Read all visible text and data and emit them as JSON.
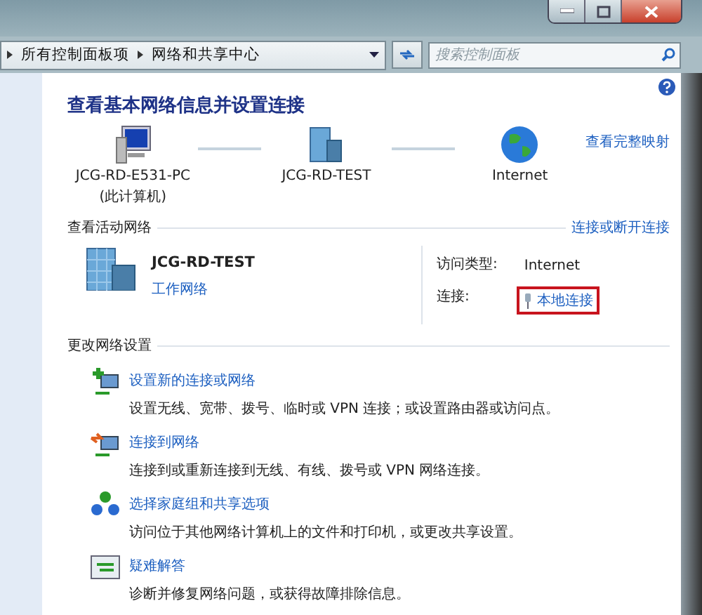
{
  "breadcrumb": [
    "所有控制面板项",
    "网络和共享中心"
  ],
  "search": {
    "placeholder": "搜索控制面板"
  },
  "title": "查看基本网络信息并设置连接",
  "full_map_link": "查看完整映射",
  "map_nodes": [
    {
      "kind": "computer",
      "name": "JCG-RD-E531-PC",
      "note": "(此计算机)"
    },
    {
      "kind": "network",
      "name": "JCG-RD-TEST"
    },
    {
      "kind": "internet",
      "name": "Internet"
    }
  ],
  "active_networks": {
    "heading": "查看活动网络",
    "link": "连接或断开连接",
    "network_name": "JCG-RD-TEST",
    "network_type": "工作网络",
    "properties": [
      {
        "kind": "text",
        "label": "访问类型:",
        "value": "Internet",
        "highlighted": false
      },
      {
        "kind": "link",
        "label": "连接:",
        "value": "本地连接",
        "highlighted": true
      }
    ]
  },
  "change_settings": {
    "heading": "更改网络设置",
    "tasks": [
      {
        "kind": "new-connection",
        "title": "设置新的连接或网络",
        "description": "设置无线、宽带、拨号、临时或 VPN 连接；或设置路由器或访问点。"
      },
      {
        "kind": "connect",
        "title": "连接到网络",
        "description": "连接到或重新连接到无线、有线、拨号或 VPN 网络连接。"
      },
      {
        "kind": "homegroup",
        "title": "选择家庭组和共享选项",
        "description": "访问位于其他网络计算机上的文件和打印机，或更改共享设置。"
      },
      {
        "kind": "troubleshoot",
        "title": "疑难解答",
        "description": "诊断并修复网络问题，或获得故障排除信息。"
      }
    ]
  }
}
